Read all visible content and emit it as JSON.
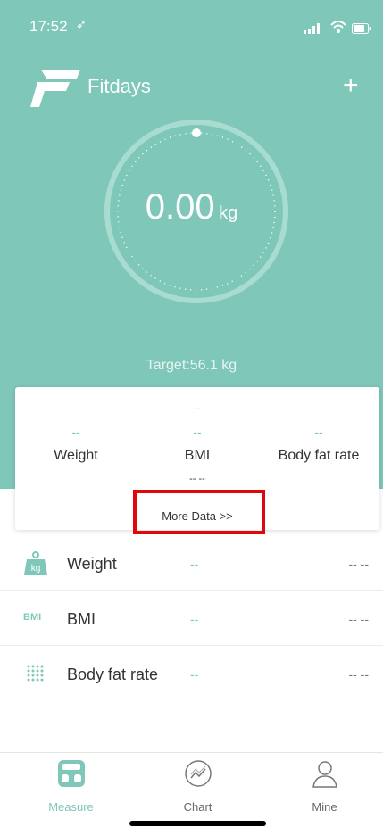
{
  "status_bar": {
    "time": "17:52",
    "location_glyph": "➶"
  },
  "header": {
    "brand": "Fitdays",
    "add_label": "+"
  },
  "scale": {
    "weight_value": "0.00",
    "unit": "kg",
    "target": "Target:56.1 kg"
  },
  "summary_card": {
    "top_value": "--",
    "metrics": [
      {
        "value": "--",
        "label": "Weight"
      },
      {
        "value": "--",
        "label": "BMI"
      },
      {
        "value": "--",
        "label": "Body fat rate"
      }
    ],
    "sub_value": "-- --",
    "more_label": "More Data >>"
  },
  "list": [
    {
      "icon": "weight-kg-icon",
      "icon_text": "kg",
      "name": "Weight",
      "value": "--",
      "right_value": "-- --"
    },
    {
      "icon": "bmi-icon",
      "icon_text": "BMI",
      "name": "BMI",
      "value": "--",
      "right_value": "-- --"
    },
    {
      "icon": "body-fat-icon",
      "icon_text": "",
      "name": "Body fat rate",
      "value": "--",
      "right_value": "-- --"
    }
  ],
  "tabs": [
    {
      "label": "Measure",
      "icon": "scale-icon",
      "active": true
    },
    {
      "label": "Chart",
      "icon": "chart-icon",
      "active": false
    },
    {
      "label": "Mine",
      "icon": "person-icon",
      "active": false
    }
  ],
  "colors": {
    "accent": "#7fc7b9",
    "highlight": "#e0060b",
    "text": "#333333"
  }
}
